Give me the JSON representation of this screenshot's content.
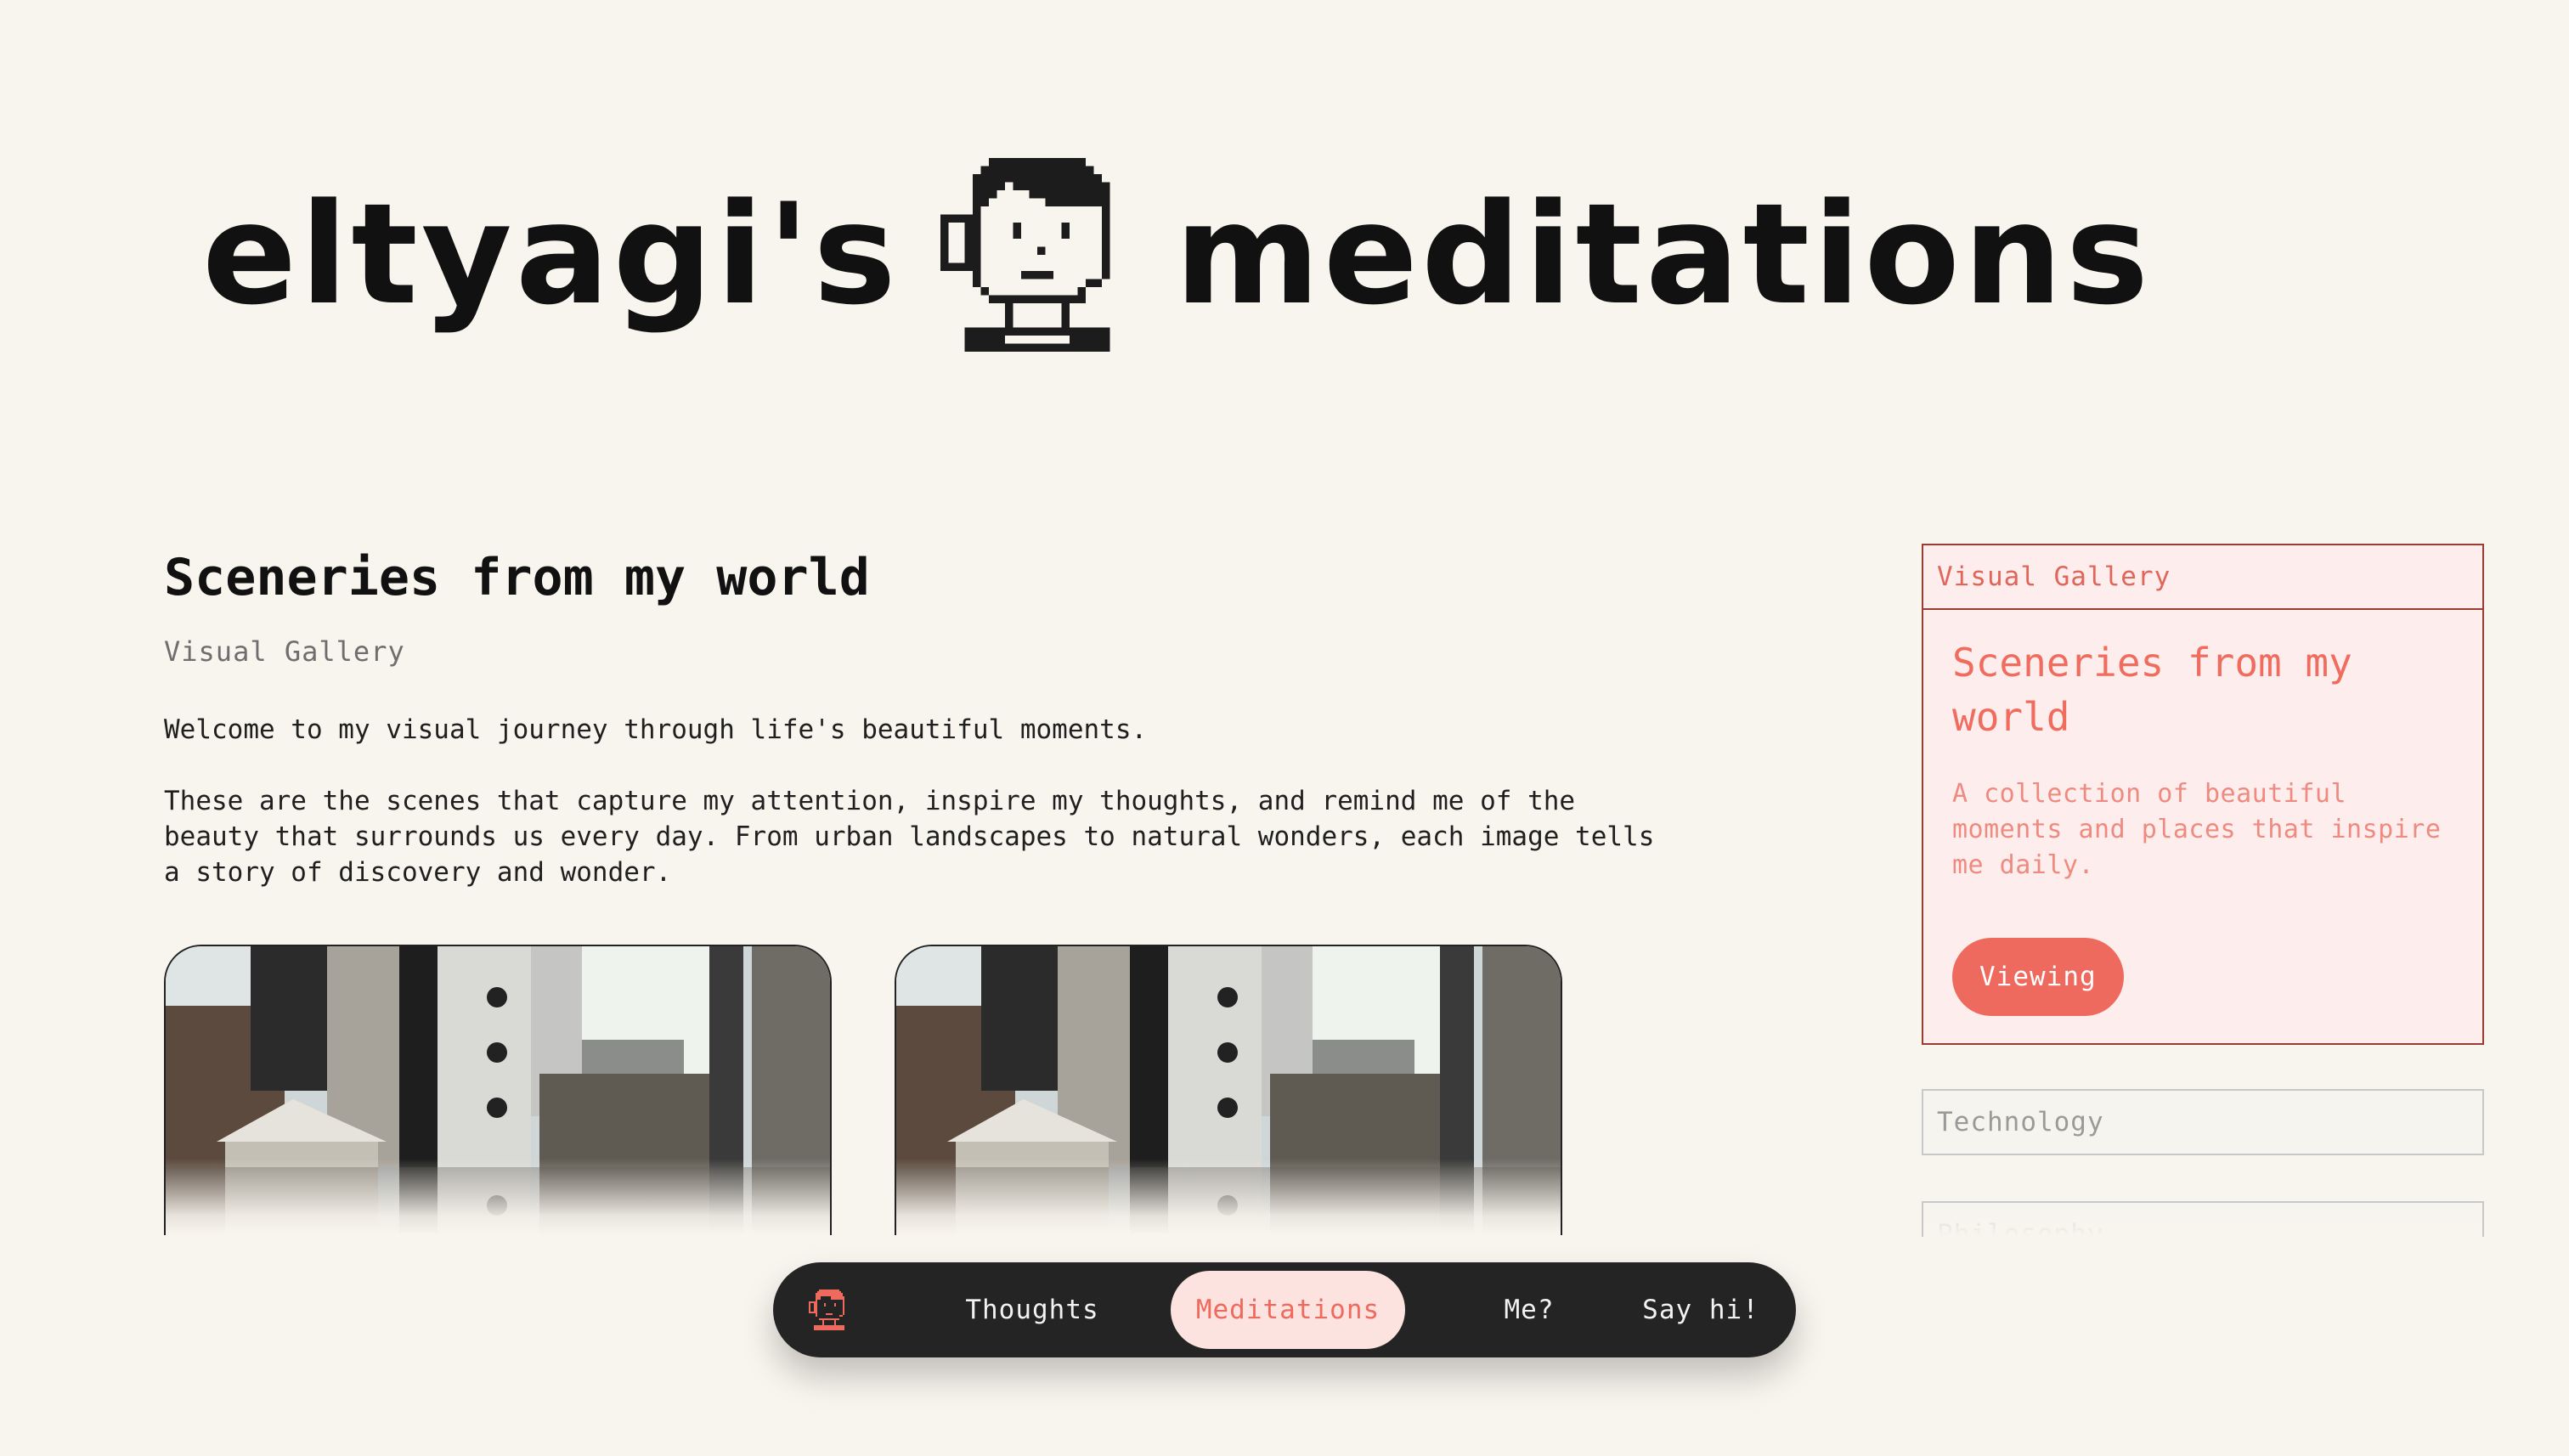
{
  "header": {
    "title_left": "eltyagi's",
    "title_right": "meditations",
    "avatar_icon": "pixel-avatar-icon"
  },
  "main": {
    "title": "Sceneries from my world",
    "subtitle": "Visual Gallery",
    "intro": [
      "Welcome to my visual journey through life's beautiful moments.",
      "These are the scenes that capture my attention, inspire my thoughts, and remind me of the beauty that surrounds us every day. From urban landscapes to natural wonders, each image tells a story of discovery and wonder."
    ]
  },
  "sidebar": {
    "active_card": {
      "tab_label": "Visual Gallery",
      "title": "Sceneries from my world",
      "description": "A collection of beautiful moments and places that inspire me daily.",
      "button_label": "Viewing"
    },
    "other_sections": [
      {
        "label": "Technology"
      },
      {
        "label": "Philosophy"
      }
    ]
  },
  "nav": {
    "logo_icon": "pixel-avatar-icon",
    "items": [
      {
        "label": "Thoughts",
        "active": false
      },
      {
        "label": "Meditations",
        "active": true
      },
      {
        "label": "Me?",
        "active": false
      },
      {
        "label": "Say hi!",
        "active": false
      }
    ]
  },
  "colors": {
    "background": "#f8f5ee",
    "accent": "#ef6a5e",
    "accent_light": "#fde3df",
    "nav_bg": "#242424"
  }
}
